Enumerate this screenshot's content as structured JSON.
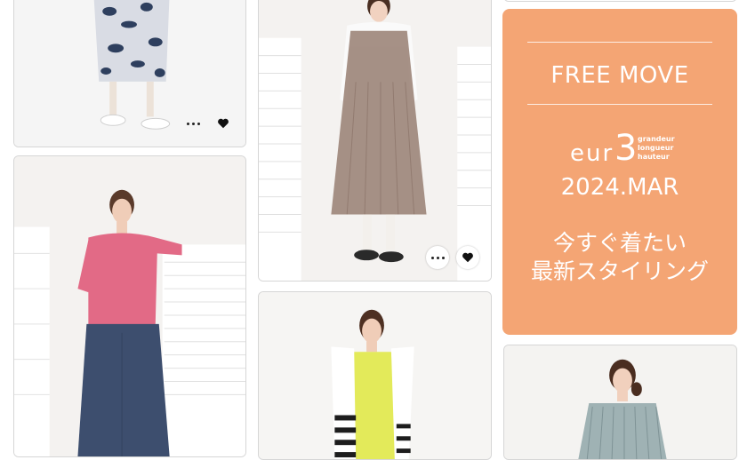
{
  "promo": {
    "title": "FREE MOVE",
    "brand_name": "eur",
    "brand_number": "3",
    "brand_tags": [
      "grandeur",
      "longueur",
      "hauteur"
    ],
    "date": "2024.MAR",
    "headline_line1": "今すぐ着たい",
    "headline_line2": "最新スタイリング",
    "bg_color": "#f4a574"
  },
  "cards": [
    {
      "id": "floral-skirt-look",
      "actions": [
        "more-icon",
        "heart-icon"
      ]
    },
    {
      "id": "pink-blouse-look"
    },
    {
      "id": "sheer-camisole-dress-look",
      "actions": [
        "more-icon",
        "heart-icon"
      ]
    },
    {
      "id": "striped-cardigan-look"
    },
    {
      "id": "striped-shirt-look"
    }
  ]
}
